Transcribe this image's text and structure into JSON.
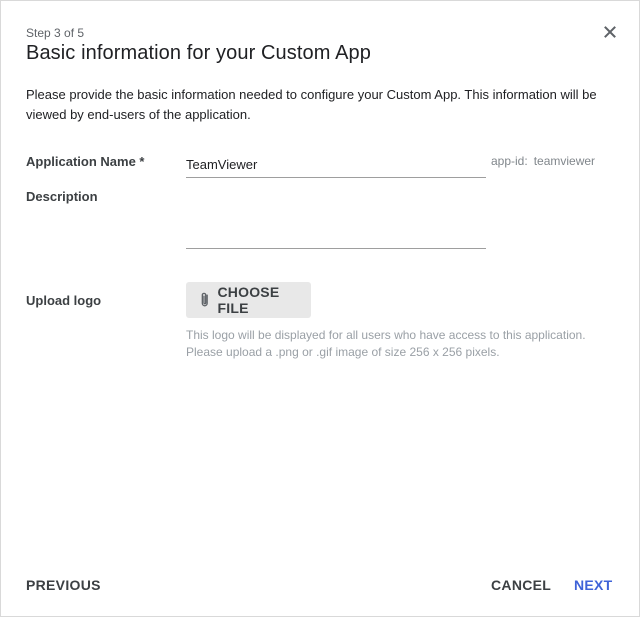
{
  "header": {
    "step": "Step 3 of 5",
    "title": "Basic information for your Custom App"
  },
  "intro": "Please provide the basic information needed to configure your Custom App. This information will be viewed by end-users of the application.",
  "form": {
    "name_label": "Application Name *",
    "name_value": "TeamViewer",
    "app_id_label": "app-id:",
    "app_id_value": "teamviewer",
    "description_label": "Description",
    "description_value": "",
    "logo_label": "Upload logo",
    "choose_file_label": "CHOOSE FILE",
    "hint_line1": "This logo will be displayed for all users who have access to this application.",
    "hint_line2": "Please upload a .png or .gif image of size 256 x 256 pixels."
  },
  "footer": {
    "previous_label": "PREVIOUS",
    "cancel_label": "CANCEL",
    "next_label": "NEXT"
  },
  "colors": {
    "accent": "#3f63d8",
    "button_bg": "#e8e8e8",
    "hint_text": "#9aa0a6"
  },
  "icons": {
    "close": "close-icon",
    "attach": "paperclip-icon"
  }
}
